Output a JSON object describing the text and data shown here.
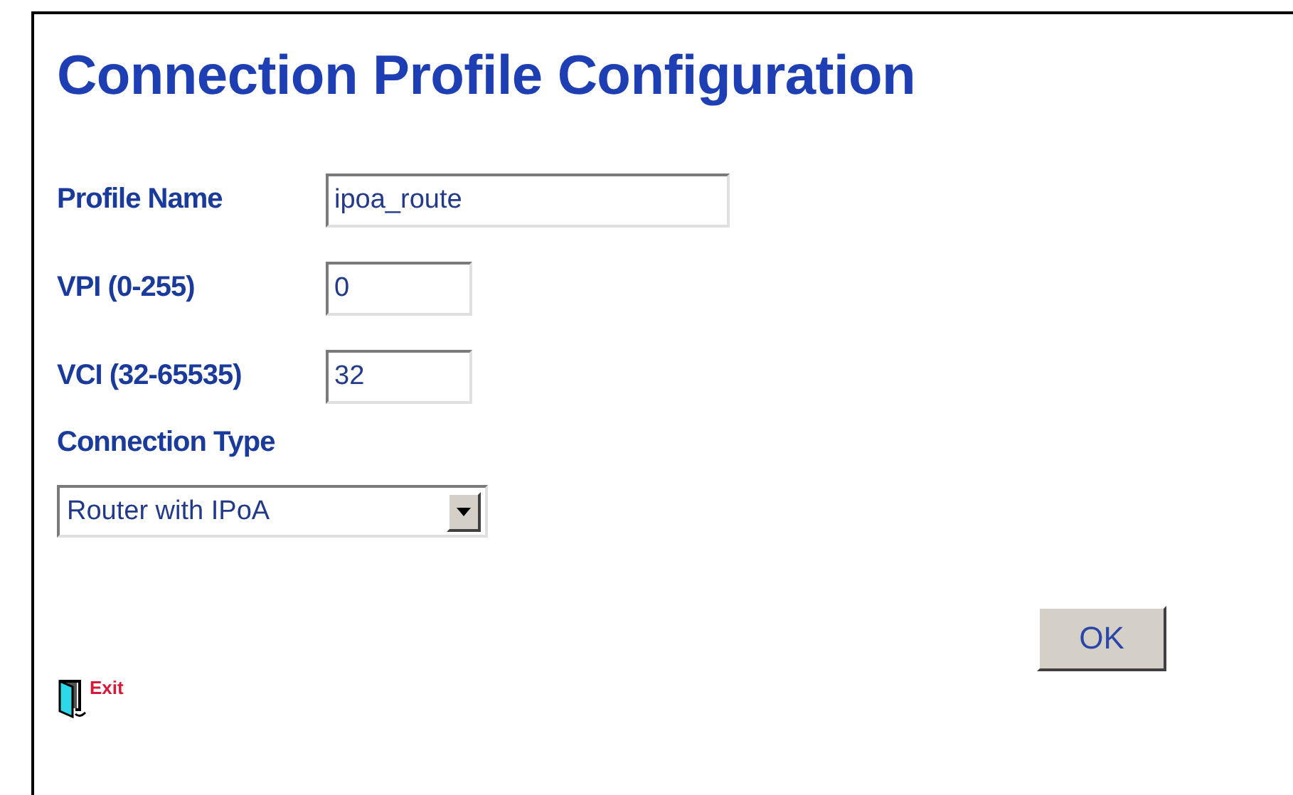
{
  "title": "Connection Profile Configuration",
  "fields": [
    {
      "label": "Profile Name",
      "value": "ipoa_route",
      "kind": "wide"
    },
    {
      "label": "VPI (0-255)",
      "value": "0",
      "kind": "narrow"
    },
    {
      "label": "VCI (32-65535)",
      "value": "32",
      "kind": "narrow"
    }
  ],
  "connection_type": {
    "label": "Connection Type",
    "value": "Router with IPoA"
  },
  "ok_button": "OK",
  "exit_link": "Exit"
}
